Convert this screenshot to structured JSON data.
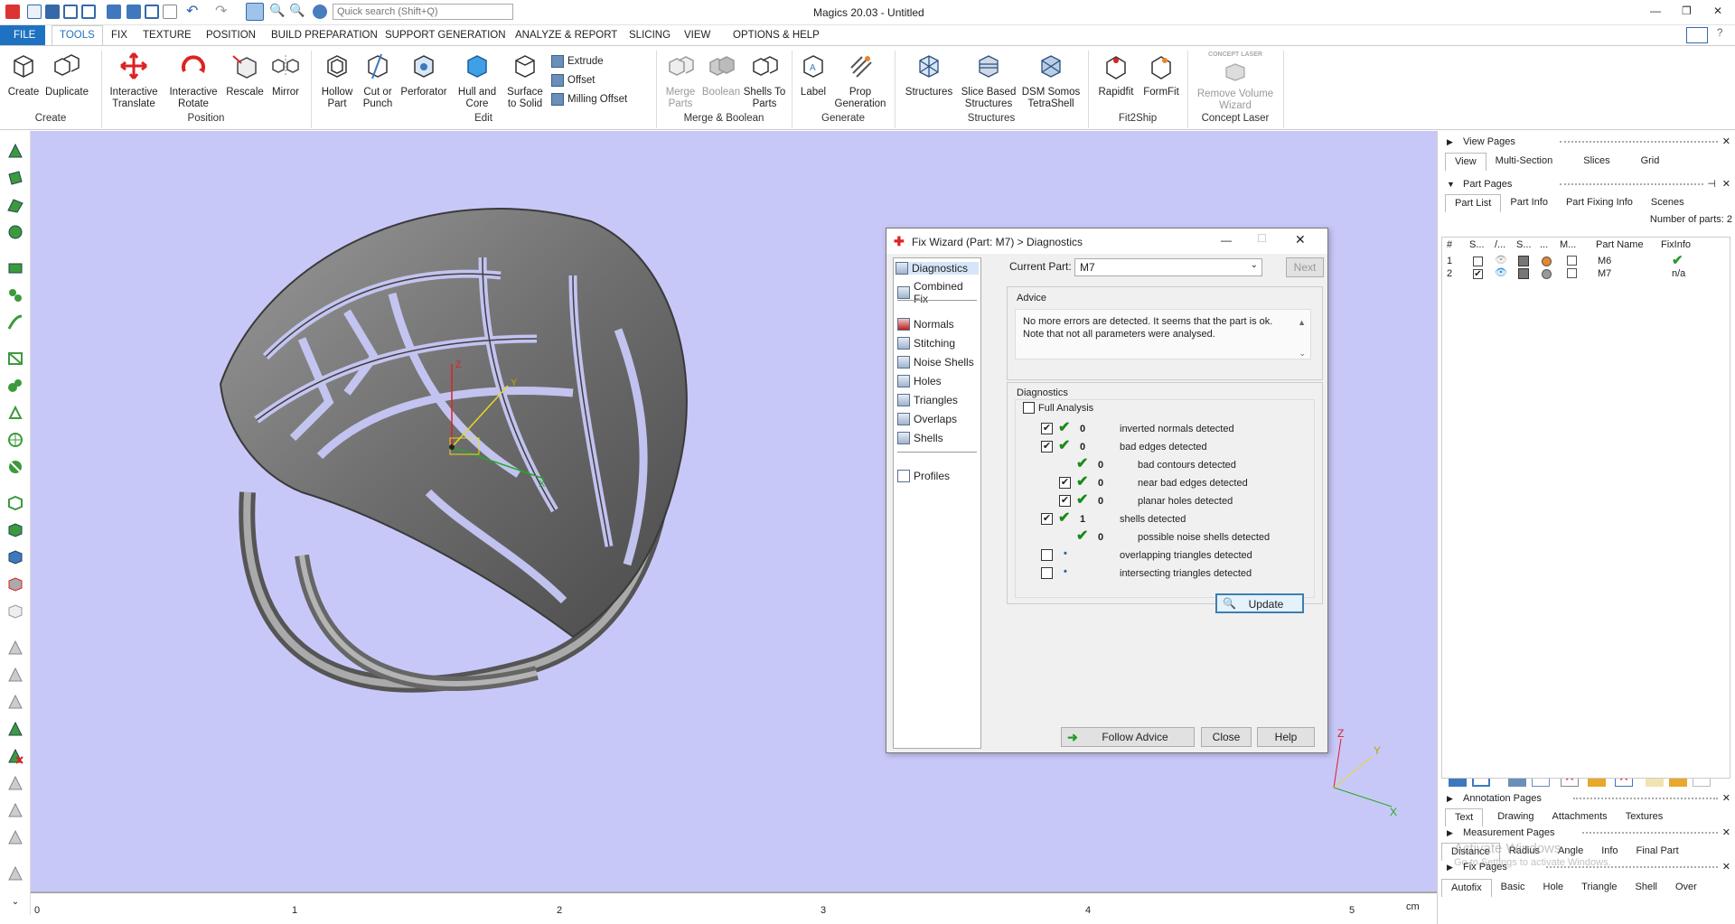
{
  "app": {
    "title": "Magics 20.03 - Untitled",
    "quick_search_placeholder": "Quick search (Shift+Q)"
  },
  "menu": [
    "FILE",
    "TOOLS",
    "FIX",
    "TEXTURE",
    "POSITION",
    "BUILD PREPARATION",
    "SUPPORT GENERATION",
    "ANALYZE & REPORT",
    "SLICING",
    "VIEW",
    "OPTIONS & HELP"
  ],
  "ribbon": {
    "create": {
      "create": "Create",
      "duplicate": "Duplicate",
      "group": "Create"
    },
    "position": {
      "translate": "Interactive Translate",
      "rotate": "Interactive Rotate",
      "rescale": "Rescale",
      "mirror": "Mirror",
      "group": "Position"
    },
    "edit": {
      "hollow": "Hollow Part",
      "cut": "Cut or Punch",
      "perforator": "Perforator",
      "hull": "Hull and Core",
      "surface": "Surface to Solid",
      "extrude": "Extrude",
      "offset": "Offset",
      "milling": "Milling Offset",
      "group": "Edit"
    },
    "merge": {
      "merge": "Merge Parts",
      "boolean": "Boolean",
      "shells": "Shells To Parts",
      "group": "Merge & Boolean"
    },
    "generate": {
      "label": "Label",
      "prop": "Prop Generation",
      "group": "Generate"
    },
    "structures": {
      "structures": "Structures",
      "slice_based": "Slice Based Structures",
      "dsm": "DSM Somos TetraShell",
      "group": "Structures"
    },
    "fit2ship": {
      "rapidfit": "Rapidfit",
      "formfit": "FormFit",
      "group": "Fit2Ship"
    },
    "concept": {
      "remove": "Remove Volume Wizard",
      "group": "Concept Laser",
      "logo": "CONCEPT LASER"
    }
  },
  "ruler": {
    "unit": "cm",
    "ticks": [
      "0",
      "1",
      "2",
      "3",
      "4",
      "5"
    ]
  },
  "axes": {
    "x": "X",
    "y": "Y",
    "z": "Z"
  },
  "right_panel": {
    "view_pages": {
      "title": "View Pages",
      "tabs": [
        "View",
        "Multi-Section",
        "Slices",
        "Grid"
      ]
    },
    "part_pages": {
      "title": "Part Pages",
      "tabs": [
        "Part List",
        "Part Info",
        "Part Fixing Info",
        "Scenes"
      ],
      "num_parts": "Number of parts: 2"
    },
    "columns": {
      "num": "#",
      "s": "S...",
      "v": "/...",
      "sh": "S...",
      "c": "...",
      "m": "M...",
      "name": "Part Name",
      "fix": "FixInfo"
    },
    "parts": [
      {
        "num": "1",
        "name": "M6",
        "fix": "✔",
        "color": "#e8862c"
      },
      {
        "num": "2",
        "name": "M7",
        "fix": "n/a",
        "color": "#999999"
      }
    ],
    "annotation_pages": {
      "title": "Annotation Pages",
      "tabs": [
        "Text",
        "Drawing",
        "Attachments",
        "Textures"
      ]
    },
    "measurement_pages": {
      "title": "Measurement Pages",
      "tabs": [
        "Distance",
        "Radius",
        "Angle",
        "Info",
        "Final Part"
      ]
    },
    "fix_pages": {
      "title": "Fix Pages",
      "tabs": [
        "Autofix",
        "Basic",
        "Hole",
        "Triangle",
        "Shell",
        "Over"
      ]
    },
    "watermark_1": "Activate Windows",
    "watermark_2": "Go to Settings to activate Windows."
  },
  "dialog": {
    "title": "Fix Wizard (Part: M7) > Diagnostics",
    "nav": [
      "Diagnostics",
      "Combined Fix",
      "Normals",
      "Stitching",
      "Noise Shells",
      "Holes",
      "Triangles",
      "Overlaps",
      "Shells",
      "Profiles"
    ],
    "current_part_label": "Current Part:",
    "current_part_value": "M7",
    "next": "Next",
    "advice_title": "Advice",
    "advice_text": "No more errors are detected. It seems that the part is ok. Note that not all parameters were analysed.",
    "diagnostics_title": "Diagnostics",
    "full_analysis": "Full Analysis",
    "rows": [
      {
        "num": "0",
        "label": "inverted normals detected"
      },
      {
        "num": "0",
        "label": "bad edges detected"
      },
      {
        "num": "0",
        "label": "bad contours detected"
      },
      {
        "num": "0",
        "label": "near bad edges detected"
      },
      {
        "num": "0",
        "label": "planar holes detected"
      },
      {
        "num": "1",
        "label": "shells detected"
      },
      {
        "num": "0",
        "label": "possible noise shells detected"
      },
      {
        "num": "•",
        "label": "overlapping triangles detected"
      },
      {
        "num": "•",
        "label": "intersecting triangles detected"
      }
    ],
    "update": "Update",
    "follow_advice": "Follow Advice",
    "close": "Close",
    "help": "Help"
  },
  "colors": {
    "viewport": "#c8c8f8",
    "accent": "#1f72c1",
    "model": "#6e6e6e"
  }
}
